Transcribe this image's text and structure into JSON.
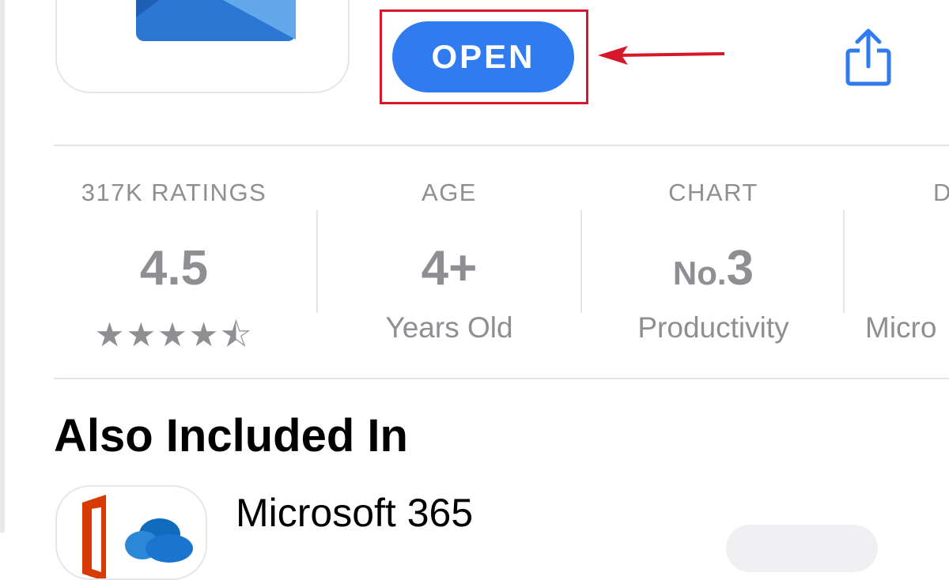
{
  "header": {
    "open_label": "OPEN"
  },
  "info": {
    "ratings": {
      "label": "317K RATINGS",
      "value": "4.5",
      "stars": "★★★★",
      "half_star": "⯪"
    },
    "age": {
      "label": "AGE",
      "value": "4+",
      "sub": "Years Old"
    },
    "chart": {
      "label": "CHART",
      "prefix": "No.",
      "value": "3",
      "sub": "Productivity"
    },
    "developer": {
      "label": "D",
      "sub": "Micro"
    }
  },
  "also_included": {
    "title": "Also Included In",
    "items": [
      {
        "name": "Microsoft 365"
      }
    ]
  },
  "colors": {
    "accent": "#2f7bef",
    "annotation": "#d7182a",
    "muted_text": "#8e8e93"
  },
  "icons": [
    "app-icon",
    "share-icon",
    "annotation-arrow-icon",
    "microsoft-365-icon"
  ]
}
